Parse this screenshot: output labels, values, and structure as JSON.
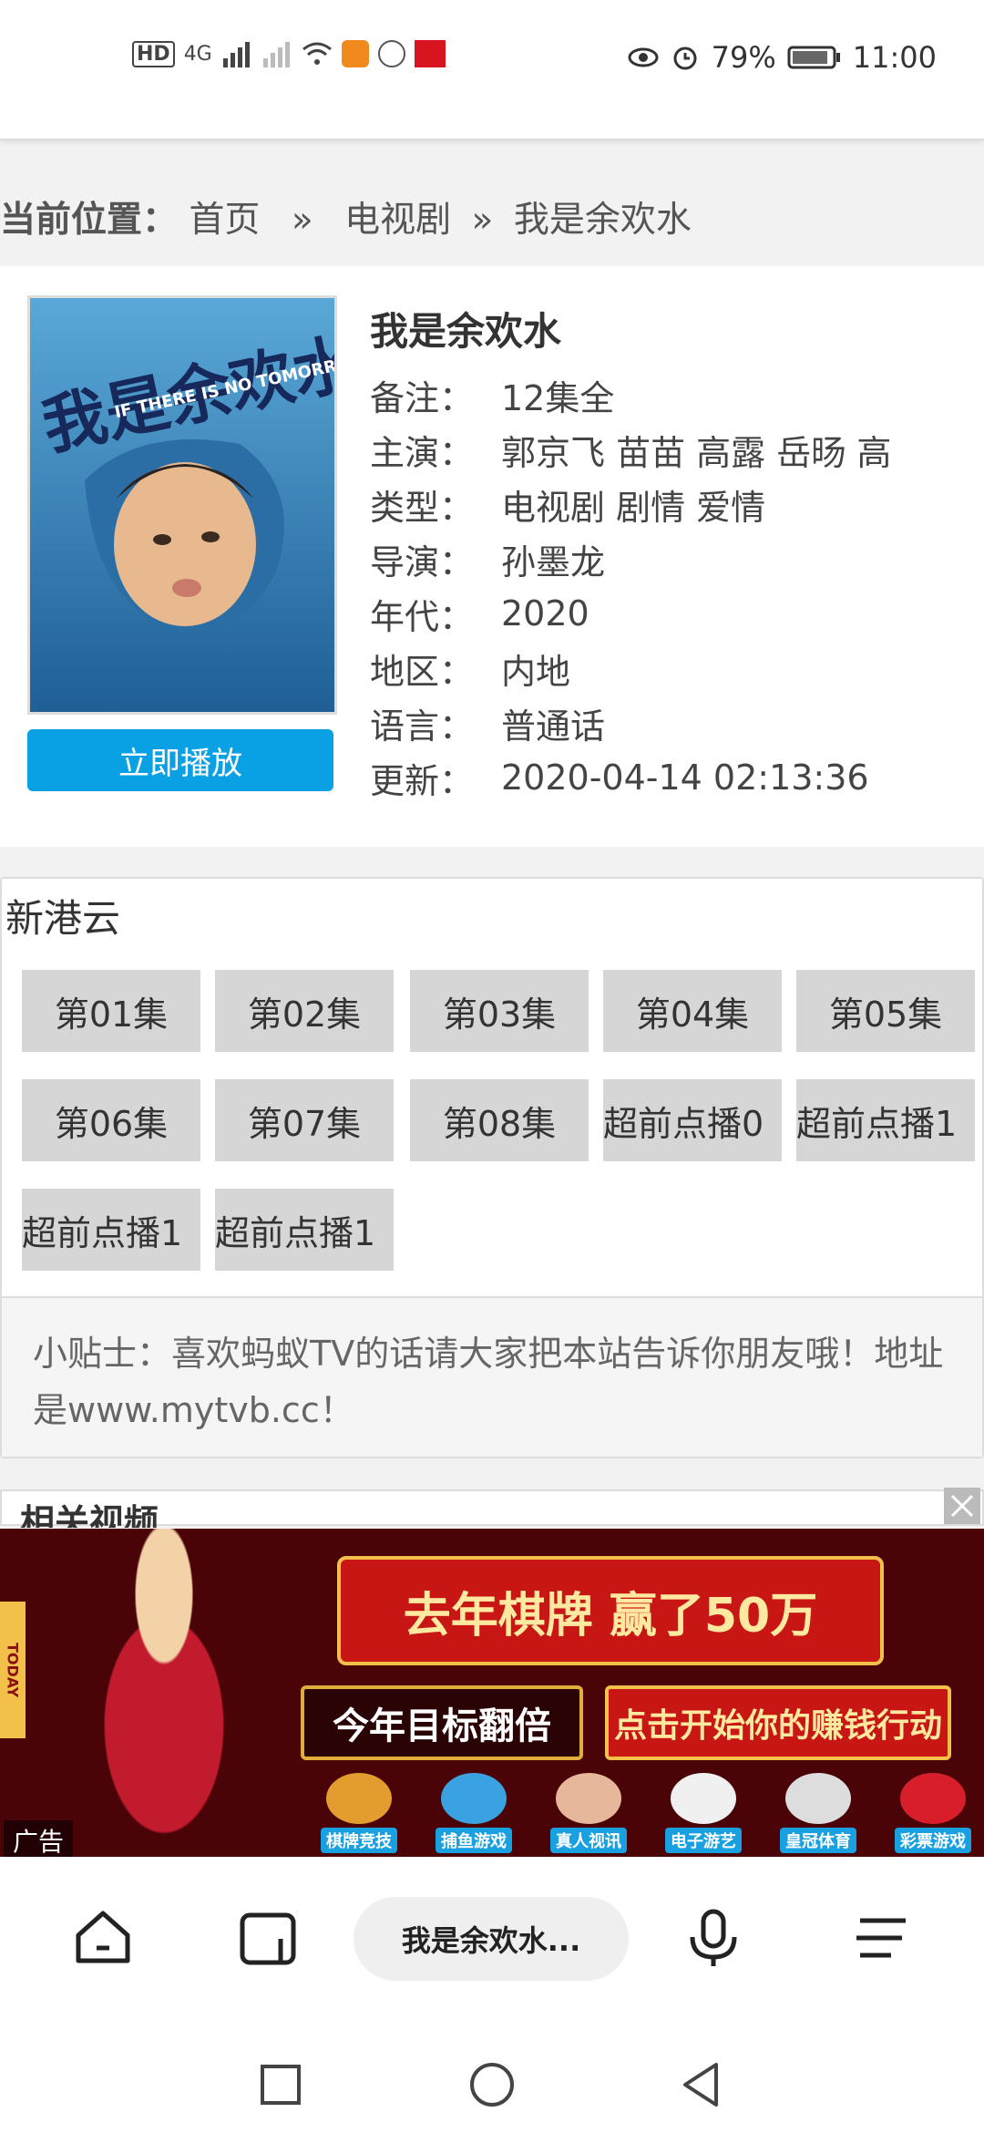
{
  "status_bar": {
    "battery": "79%",
    "time": "11:00",
    "network": "4G",
    "hd_label": "HD"
  },
  "breadcrumb": {
    "prefix": "当前位置：",
    "home": "首页",
    "sep1": "»",
    "category": "电视剧",
    "sep2": "»",
    "current": "我是余欢水"
  },
  "detail": {
    "title": "我是余欢水",
    "play_button": "立即播放",
    "fields": [
      {
        "label": "备注：",
        "value": "12集全"
      },
      {
        "label": "主演：",
        "value": "郭京飞 苗苗 高露 岳旸 高"
      },
      {
        "label": "类型：",
        "value": "电视剧  剧情 爱情"
      },
      {
        "label": "导演：",
        "value": "孙墨龙"
      },
      {
        "label": "年代：",
        "value": "2020"
      },
      {
        "label": "地区：",
        "value": "内地"
      },
      {
        "label": "语言：",
        "value": "普通话"
      },
      {
        "label": "更新：",
        "value": "2020-04-14 02:13:36"
      }
    ],
    "poster_text": "我是余欢水",
    "poster_subtitle": "IF THERE IS NO TOMORROW"
  },
  "episodes": {
    "source": "新港云",
    "items": [
      "第01集",
      "第02集",
      "第03集",
      "第04集",
      "第05集",
      "第06集",
      "第07集",
      "第08集",
      "超前点播0",
      "超前点播1",
      "超前点播1",
      "超前点播1"
    ]
  },
  "tip": {
    "text": "小贴士：喜欢蚂蚁TV的话请大家把本站告诉你朋友哦！地址是www.mytvb.cc！"
  },
  "related": {
    "title": "相关视频"
  },
  "ad": {
    "label": "广告",
    "headline": "去年棋牌 赢了50万",
    "button1": "今年目标翻倍",
    "button2": "点击开始你的赚钱行动",
    "games": [
      "棋牌竞技",
      "捕鱼游戏",
      "真人视讯",
      "电子游艺",
      "皇冠体育",
      "彩票游戏"
    ],
    "brand": "TODAY"
  },
  "browser": {
    "tab_title": "我是余欢水..."
  },
  "colors": {
    "accent": "#0aa0e4",
    "episode_bg": "#d6d6d6"
  }
}
